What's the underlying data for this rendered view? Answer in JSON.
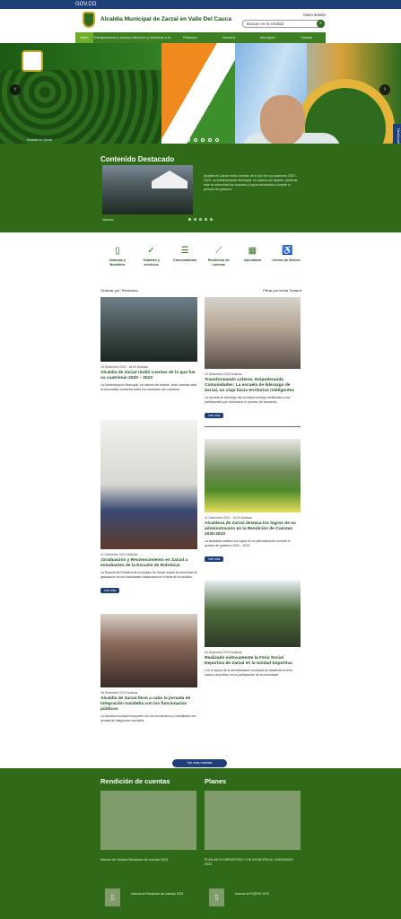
{
  "topbar": {
    "label": "GOV.CO"
  },
  "header": {
    "title": "Alcaldía Municipal de Zarzal en Valle Del Cauca",
    "search_placeholder": "Buscar en la entidad",
    "top_link": "Inicio sesión"
  },
  "nav": {
    "items": [
      "Inicio",
      "Transparencia y acceso a la información pública",
      "Atención y servicios a la ciudadanía",
      "Participa",
      "Nuestra",
      "Municipio",
      "Ciudad"
    ]
  },
  "slider": {
    "caption": "Alcaldía de Zarzal",
    "side_tab": "Destacado"
  },
  "featured": {
    "heading": "Contenido Destacado",
    "text": "Alcaldía de Zarzal rindió cuentas de lo que fue su cuatrienio 2020 – 2023. La Administración Municipal, en cabeza del alcalde, presentó ante la comunidad los avances y logros alcanzados durante el periodo de gobierno.",
    "meta": "Noticias"
  },
  "quick_links": [
    {
      "icon": "document-icon",
      "label": "Noticias y Boletines"
    },
    {
      "icon": "check-icon",
      "label": "Trámites y servicios"
    },
    {
      "icon": "list-icon",
      "label": "Convocatorias"
    },
    {
      "icon": "chart-icon",
      "label": "Rendición de cuentas"
    },
    {
      "icon": "calendar-icon",
      "label": "Calendario"
    },
    {
      "icon": "accessibility-icon",
      "label": "Centro de Relevo"
    }
  ],
  "filters": {
    "left": "Ordenar por: Recientes",
    "right": "Filtrar por fecha  Todas  ▾"
  },
  "news": [
    {
      "meta": "15 Diciembre 2023 - 16:00 Noticias",
      "title": "Alcaldía de Zarzal rindió cuentas de lo que fue su cuatrienio 2020 – 2023",
      "summary": "La Administración Municipal, en cabeza del alcalde, rindió cuentas ante la comunidad zarzaleña sobre los resultados del cuatrienio.",
      "more": ""
    },
    {
      "meta": "15 Diciembre 2023 Noticias",
      "title": "Transformando Líderes, Empoderando Comunidades: La escuela de liderazgo de Zarzal, un viaje hacia territorios inteligentes",
      "summary": "La escuela de liderazgo del municipio entregó certificados a los participantes que culminaron el proceso de formación.",
      "more": "Leer más"
    },
    {
      "meta": "11 Diciembre 2023 Noticias",
      "title": "¡Graduación y Reconocimiento en Zarzal a estudiantes de la Escuela de Robótica!",
      "summary": "La Escuela de Robótica de la Alcaldía de Zarzal realizó la ceremonia de graduación de sus estudiantes destacados en el área de la robótica.",
      "more": "Leer más"
    },
    {
      "meta": "11 Diciembre 2023 - 15:00 Noticias",
      "title": "Alcaldesa de Zarzal destaca los logros de su administración en la Rendición de Cuentas 2020-2023",
      "summary": "La alcaldesa destacó los logros de su administración durante el periodo de gobierno 2020 – 2023.",
      "more": "Leer más"
    },
    {
      "meta": "06 Diciembre 2023 Noticias",
      "title": "Alcaldía de Zarzal llevó a cabo la jornada de integración navideña con los funcionarios públicos",
      "summary": "La Alcaldía municipal compartió con los funcionarios y contratistas una jornada de integración navideña.",
      "more": ""
    },
    {
      "meta": "04 Diciembre 2023 Noticias",
      "title": "Realizado exitosamente la Feria Social Deportiva de Zarzal en la Unidad Deportiva",
      "summary": "Con el apoyo de la administración municipal se desarrolló la feria social y deportiva con la participación de la comunidad.",
      "more": ""
    }
  ],
  "load_more": "Ver más noticias",
  "footer": {
    "left_heading": "Rendición de cuentas",
    "right_heading": "Planes",
    "left_caption": "Informe de Gestión Rendición de cuentas 2023",
    "right_caption": "PLAN ANTICORRUPCIÓN Y DE ATENCIÓN AL CIUDADANO 2023",
    "docs": [
      "Informe de Rendición de cuentas 2023",
      "Informe de PQRSD 2023"
    ]
  },
  "colors": {
    "primary_green": "#2f6a18",
    "gov_blue": "#1e3f7a",
    "accent_green": "#6fae2a"
  }
}
